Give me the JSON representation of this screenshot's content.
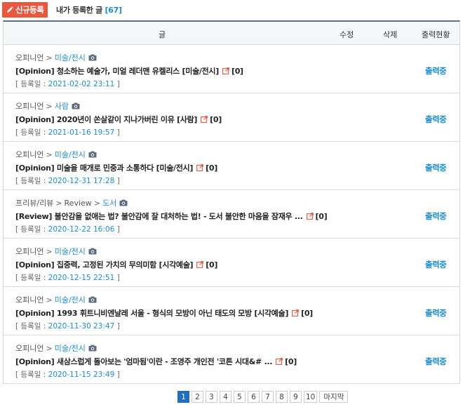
{
  "toolbar": {
    "new_button": "신규등록",
    "my_posts_label": "내가 등록한 글",
    "my_posts_count": "[67]"
  },
  "table": {
    "headers": {
      "article": "글",
      "edit": "수정",
      "delete": "삭제",
      "status": "출력현황"
    },
    "date_prefix": "[ 등록일 : ",
    "date_suffix": " ]",
    "rows": [
      {
        "section": "오피니언",
        "sub": "",
        "category": "미술/전시",
        "title": "[Opinion] 청소하는 예술가, 미얼 레더맨 유켈리스 [미술/전시]",
        "comments": "[0]",
        "date": "2021-02-02 23:11",
        "status": "출력중"
      },
      {
        "section": "오피니언",
        "sub": "",
        "category": "사람",
        "title": "[Opinion] 2020년이 쏜살같이 지나가버린 이유 [사람]",
        "comments": "[0]",
        "date": "2021-01-16 19:57",
        "status": "출력중"
      },
      {
        "section": "오피니언",
        "sub": "",
        "category": "미술/전시",
        "title": "[Opinion] 미술을 매개로 민중과 소통하다 [미술/전시]",
        "comments": "[0]",
        "date": "2020-12-31 17:28",
        "status": "출력중"
      },
      {
        "section": "프리뷰/리뷰",
        "sub": "Review",
        "category": "도서",
        "title": "[Review] 불안감을 없애는 법? 불안감에 잘 대처하는 법! - 도서 불안한 마음을 잠재우 ...",
        "comments": "[0]",
        "date": "2020-12-22 16:06",
        "status": "출력중"
      },
      {
        "section": "오피니언",
        "sub": "",
        "category": "미술/전시",
        "title": "[Opinion] 집중력, 고정된 가치의 무의미함 [시각예술]",
        "comments": "[0]",
        "date": "2020-12-15 22:51",
        "status": "출력중"
      },
      {
        "section": "오피니언",
        "sub": "",
        "category": "미술/전시",
        "title": "[Opinion] 1993 휘트니비엔날레 서울 - 형식의 모방이 아닌 태도의 모방 [시각예술]",
        "comments": "[0]",
        "date": "2020-11-30 23:47",
        "status": "출력중"
      },
      {
        "section": "오피니언",
        "sub": "",
        "category": "미술/전시",
        "title": "[Opinion] 새삼스럽게 돌아보는 '엄마됨'이란 - 조영주 개인전 '코튼 시대&# ...",
        "comments": "[0]",
        "date": "2020-11-15 23:49",
        "status": "출력중"
      }
    ]
  },
  "pagination": {
    "pages": [
      "1",
      "2",
      "3",
      "4",
      "5",
      "6",
      "7",
      "8",
      "9",
      "10"
    ],
    "current": "1",
    "last_label": "마지막"
  },
  "colors": {
    "accent": "#e9573f",
    "link": "#1b8ed3",
    "page_active": "#1e6fc2",
    "header_border": "#5b6f8c"
  },
  "icons": {
    "new": "pencil-icon",
    "photo": "camera-icon",
    "open": "external-link-icon"
  }
}
